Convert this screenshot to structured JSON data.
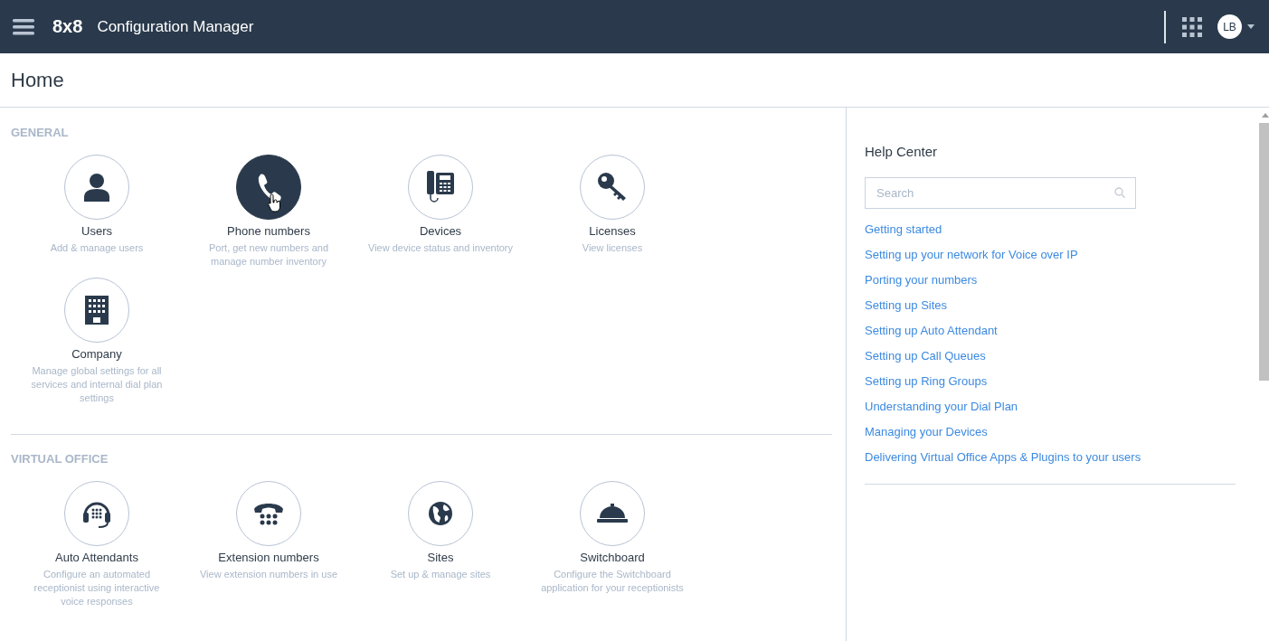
{
  "topbar": {
    "logo": "8x8",
    "title": "Configuration Manager",
    "avatar": "LB"
  },
  "page_title": "Home",
  "sections": [
    {
      "heading": "GENERAL",
      "tiles": [
        {
          "kind": "user",
          "title": "Users",
          "description": "Add & manage users",
          "highlighted": false
        },
        {
          "kind": "phone",
          "title": "Phone numbers",
          "description": "Port, get new numbers and manage number inventory",
          "highlighted": true
        },
        {
          "kind": "desk-phone",
          "title": "Devices",
          "description": "View device status and inventory",
          "highlighted": false
        },
        {
          "kind": "key",
          "title": "Licenses",
          "description": "View licenses",
          "highlighted": false
        },
        {
          "kind": "building",
          "title": "Company",
          "description": "Manage global settings for all services and internal dial plan settings",
          "highlighted": false
        }
      ]
    },
    {
      "heading": "VIRTUAL OFFICE",
      "tiles": [
        {
          "kind": "headset",
          "title": "Auto Attendants",
          "description": "Configure an automated receptionist using interactive voice responses",
          "highlighted": false
        },
        {
          "kind": "rotary",
          "title": "Extension numbers",
          "description": "View extension numbers in use",
          "highlighted": false
        },
        {
          "kind": "globe",
          "title": "Sites",
          "description": "Set up & manage sites",
          "highlighted": false
        },
        {
          "kind": "bell",
          "title": "Switchboard",
          "description": "Configure the Switchboard application for your receptionists",
          "highlighted": false
        }
      ]
    }
  ],
  "help": {
    "title": "Help Center",
    "search": {
      "placeholder": "Search"
    },
    "links": [
      "Getting started",
      "Setting up your network for Voice over IP",
      "Porting your numbers",
      "Setting up Sites",
      "Setting up Auto Attendant",
      "Setting up Call Queues",
      "Setting up Ring Groups",
      "Understanding your Dial Plan",
      "Managing your Devices",
      "Delivering Virtual Office Apps & Plugins to your users"
    ]
  }
}
